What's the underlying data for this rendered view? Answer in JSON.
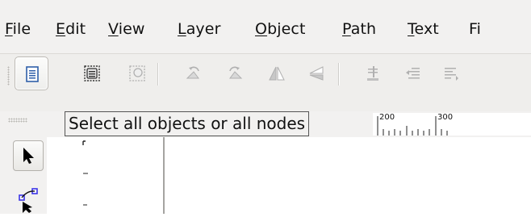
{
  "menubar": {
    "items": [
      {
        "accel": "F",
        "rest": "ile"
      },
      {
        "accel": "E",
        "rest": "dit"
      },
      {
        "accel": "V",
        "rest": "iew"
      },
      {
        "accel": "L",
        "rest": "ayer"
      },
      {
        "accel": "O",
        "rest": "bject"
      },
      {
        "accel": "P",
        "rest": "ath"
      },
      {
        "accel": "T",
        "rest": "ext"
      },
      {
        "accel": "",
        "rest": "Fi"
      }
    ]
  },
  "toolbar": {
    "buttons": [
      {
        "icon": "select-all-icon",
        "pressed": true
      },
      {
        "icon": "select-all-layers-icon"
      },
      {
        "icon": "deselect-icon"
      },
      {
        "icon": "rotate-ccw-icon"
      },
      {
        "icon": "rotate-cw-icon"
      },
      {
        "icon": "flip-horizontal-icon"
      },
      {
        "icon": "flip-vertical-icon"
      },
      {
        "icon": "lower-to-bottom-icon"
      },
      {
        "icon": "raise-to-top-icon"
      },
      {
        "icon": "align-icon"
      }
    ]
  },
  "tooltip": {
    "text": "Select all objects or all nodes"
  },
  "ruler": {
    "labels": [
      "200",
      "300"
    ]
  },
  "toolbox": {
    "tools": [
      {
        "icon": "selector-arrow-icon",
        "pressed": true
      },
      {
        "icon": "node-editor-icon"
      }
    ]
  },
  "colors": {
    "accent": "#2f5fa8",
    "node": "#3b34e6"
  }
}
